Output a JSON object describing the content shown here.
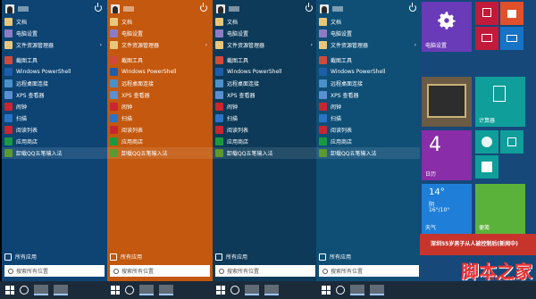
{
  "panels": [
    {
      "bg": "#0d4474",
      "highlight_index": 12
    },
    {
      "bg": "#c3580e",
      "highlight_index": 12
    },
    {
      "bg": "#0d3a58",
      "highlight_index": 12
    },
    {
      "bg": "#0f4f76",
      "highlight_index": 12
    }
  ],
  "menu": {
    "items": [
      {
        "label": "文档",
        "icon": "folder-icon",
        "color": "#e8c77a",
        "arrow": false
      },
      {
        "label": "电脑设置",
        "icon": "gear-icon",
        "color": "#8c7cc4",
        "arrow": false
      },
      {
        "label": "文件资源管理器",
        "icon": "folder-icon",
        "color": "#e8c77a",
        "arrow": true
      },
      {
        "label": "截图工具",
        "icon": "scissors-icon",
        "color": "#d04a3a",
        "arrow": false
      },
      {
        "label": "Windows PowerShell",
        "icon": "powershell-icon",
        "color": "#1e5ea8",
        "arrow": false
      },
      {
        "label": "远程桌面连接",
        "icon": "remote-desktop-icon",
        "color": "#4c90c8",
        "arrow": false
      },
      {
        "label": "XPS 查看器",
        "icon": "xps-icon",
        "color": "#5a8fd0",
        "arrow": false
      },
      {
        "label": "闹钟",
        "icon": "alarm-icon",
        "color": "#c9262f",
        "arrow": false
      },
      {
        "label": "扫描",
        "icon": "scan-icon",
        "color": "#2a74c6",
        "arrow": false
      },
      {
        "label": "阅读列表",
        "icon": "reading-list-icon",
        "color": "#c9262f",
        "arrow": false
      },
      {
        "label": "应用商店",
        "icon": "store-icon",
        "color": "#1a9a3f",
        "arrow": false
      },
      {
        "label": "卸载QQ五笔输入法",
        "icon": "qq-input-icon",
        "color": "#5b9a2e",
        "arrow": false
      }
    ],
    "all_apps": "所有应用",
    "search_placeholder": "搜索所有位置"
  },
  "tiles": {
    "pc_settings": "电脑设置",
    "calculator": "计算器",
    "date_number": "4",
    "date_label": "日历",
    "weather_temp": "14°",
    "weather_desc": "阴",
    "weather_range": "16°/10°",
    "weather_label": "天气",
    "notes": "便笺",
    "news": "深圳55岁男子从人被控制后(新闻中)"
  },
  "watermark": {
    "main": "脚本之家",
    "sub": "www.jb51.net"
  }
}
